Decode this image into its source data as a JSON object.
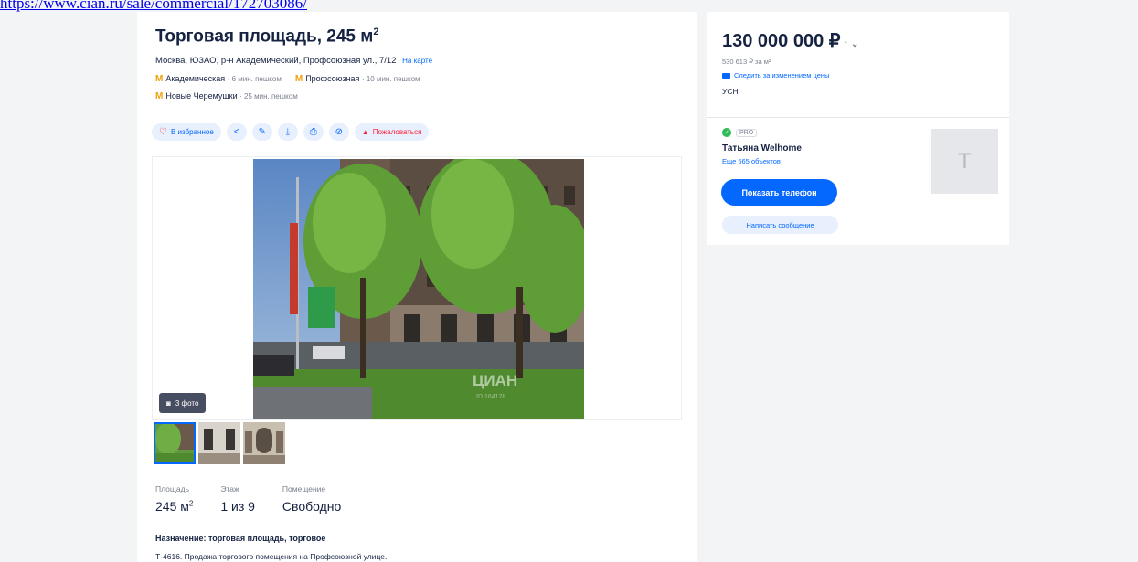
{
  "url": "https://www.cian.ru/sale/commercial/172703086/",
  "listing": {
    "title": "Торговая площадь, 245 м",
    "title_sup": "2",
    "address": "Москва, ЮЗАО, р-н Академический, Профсоюзная ул., 7/12",
    "map_link": "На карте",
    "metro": [
      {
        "icon": "М",
        "station": "Академическая",
        "walk": "· 6 мин. пешком"
      },
      {
        "icon": "М",
        "station": "Профсоюзная",
        "walk": "· 10 мин. пешком"
      },
      {
        "icon": "М",
        "station": "Новые Черемушки",
        "walk": "· 25 мин. пешком"
      }
    ],
    "actions": {
      "favorite": "В избранное",
      "complain": "Пожаловаться"
    },
    "gallery": {
      "counter": "3 фото",
      "watermark": "ЦИАН",
      "watermark_id": "ID 164178"
    },
    "params": [
      {
        "label": "Площадь",
        "value": "245 м",
        "sup": "2"
      },
      {
        "label": "Этаж",
        "value": "1 из 9",
        "sup": ""
      },
      {
        "label": "Помещение",
        "value": "Свободно",
        "sup": ""
      }
    ],
    "purpose": "Назначение: торговая площадь, торговое",
    "description": "Т-4616. Продажа торгового помещения на Профсоюзной улице."
  },
  "sidebar": {
    "price": "130 000 000 ₽",
    "price_per_m2": "530 613 ₽ за м²",
    "watch_price": "Следить за изменением цены",
    "tax": "УСН",
    "pro_tag": "PRO",
    "agent_name": "Татьяна Welhome",
    "more_objects": "Еще 565 объектов",
    "avatar_letter": "T",
    "show_phone": "Показать телефон",
    "write_message": "Написать сообщение"
  },
  "colors": {
    "accent": "#0468ff",
    "metro": "#f0a10e",
    "danger": "#ff1f34",
    "success": "#2dbb54"
  },
  "icons": {
    "favorite": "heart-icon",
    "share": "share-icon",
    "edit": "pencil-icon",
    "download": "download-icon",
    "print": "print-icon",
    "hide": "hide-icon",
    "complain": "warning-icon",
    "camera": "camera-icon",
    "price_up": "arrow-up-icon",
    "dropdown": "chevron-down-icon",
    "watch": "envelope-icon",
    "pro": "shield-check-icon"
  }
}
